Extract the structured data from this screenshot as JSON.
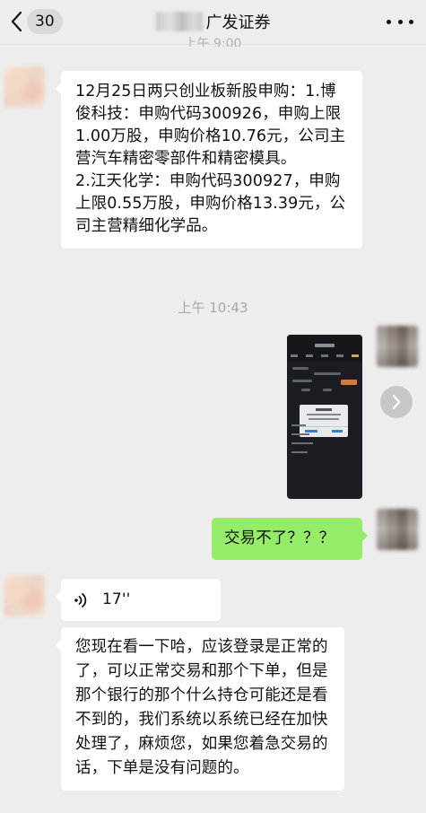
{
  "header": {
    "unread_count": "30",
    "title": "广发证券"
  },
  "top_time": "上午 9:00",
  "messages": [
    {
      "id": 1,
      "direction": "in",
      "type": "text",
      "text": "12月25日两只创业板新股申购：1.博俊科技：申购代码300926，申购上限1.00万股，申购价格10.76元，公司主营汽车精密零部件和精密模具。\n2.江天化学：申购代码300927，申购上限0.55万股，申购价格13.39元，公司主营精细化学品。"
    },
    {
      "id": 2,
      "type": "time",
      "text": "上午 10:43"
    },
    {
      "id": 3,
      "direction": "out",
      "type": "image"
    },
    {
      "id": 4,
      "direction": "out",
      "type": "text",
      "text": "交易不了？？？"
    },
    {
      "id": 5,
      "direction": "in",
      "type": "voice",
      "duration": "17''"
    },
    {
      "id": 6,
      "direction": "in",
      "type": "text",
      "text": "您现在看一下哈，应该登录是正常的了，可以正常交易和那个下单，但是那个银行的那个什么持仓可能还是看不到的，我们系统以系统已经在加快处理了，麻烦您，如果您着急交易的话，下单是没有问题的。"
    }
  ],
  "colors": {
    "background": "#ededed",
    "bubble_in": "#ffffff",
    "bubble_out": "#95ec69"
  }
}
